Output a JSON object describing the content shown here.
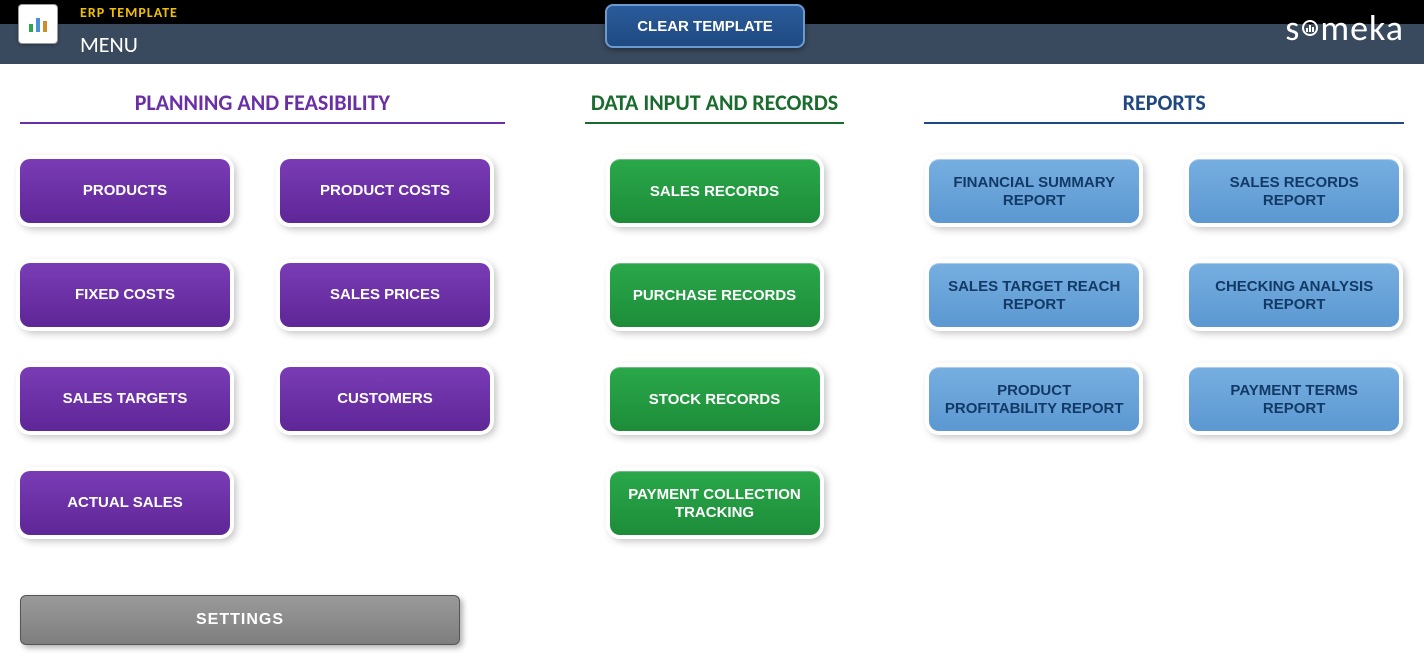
{
  "header": {
    "app_title": "ERP TEMPLATE",
    "menu_label": "MENU",
    "clear_button": "CLEAR TEMPLATE",
    "brand": "someka"
  },
  "sections": {
    "planning": {
      "title": "PLANNING AND FEASIBILITY",
      "buttons": [
        "PRODUCTS",
        "PRODUCT COSTS",
        "FIXED COSTS",
        "SALES PRICES",
        "SALES TARGETS",
        "CUSTOMERS",
        "ACTUAL SALES"
      ]
    },
    "data_input": {
      "title": "DATA INPUT AND RECORDS",
      "buttons": [
        "SALES RECORDS",
        "PURCHASE RECORDS",
        "STOCK RECORDS",
        "PAYMENT COLLECTION TRACKING"
      ]
    },
    "reports": {
      "title": "REPORTS",
      "buttons": [
        "FINANCIAL SUMMARY REPORT",
        "SALES RECORDS REPORT",
        "SALES TARGET REACH REPORT",
        "CHECKING ANALYSIS REPORT",
        "PRODUCT PROFITABILITY REPORT",
        "PAYMENT TERMS REPORT"
      ]
    }
  },
  "settings_label": "SETTINGS"
}
